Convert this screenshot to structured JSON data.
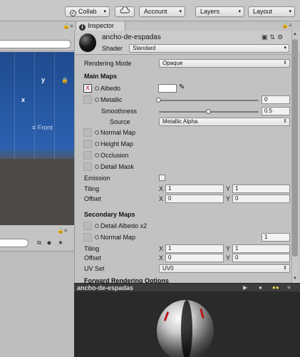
{
  "toolbar": {
    "collab_label": "Collab",
    "account_label": "Account",
    "layers_label": "Layers",
    "layout_label": "Layout"
  },
  "scene": {
    "axis_y": "y",
    "axis_x": "x",
    "view_label": "Front"
  },
  "inspector": {
    "tab_label": "Inspector",
    "material_name": "ancho-de-espadas",
    "shader_label": "Shader",
    "shader_value": "Standard",
    "rendering_mode_label": "Rendering Mode",
    "rendering_mode_value": "Opaque",
    "main_maps_title": "Main Maps",
    "albedo_label": "Albedo",
    "metallic_label": "Metallic",
    "metallic_value": "0",
    "metallic_fraction": 0,
    "smoothness_label": "Smoothness",
    "smoothness_value": "0.5",
    "smoothness_fraction": 0.5,
    "source_label": "Source",
    "source_value": "Metallic Alpha",
    "normal_map_label": "Normal Map",
    "height_map_label": "Height Map",
    "occlusion_label": "Occlusion",
    "detail_mask_label": "Detail Mask",
    "emission_label": "Emission",
    "tiling_label": "Tiling",
    "offset_label": "Offset",
    "x_label": "X",
    "y_label": "Y",
    "tiling_x": "1",
    "tiling_y": "1",
    "offset_x": "0",
    "offset_y": "0",
    "secondary_maps_title": "Secondary Maps",
    "detail_albedo_label": "Detail Albedo x2",
    "sec_normal_map_label": "Normal Map",
    "sec_normal_value": "1",
    "sec_tiling_label": "Tiling",
    "sec_offset_label": "Offset",
    "sec_tiling_x": "1",
    "sec_tiling_y": "1",
    "sec_offset_x": "0",
    "sec_offset_y": "0",
    "uv_set_label": "UV Set",
    "uv_set_value": "UV0",
    "forward_options_title": "Forward Rendering Options"
  },
  "preview": {
    "name": "ancho-de-espadas"
  },
  "colors": {
    "scene_sky": "#2c60b0",
    "scene_ground": "#4d4a45",
    "albedo": "#ffffff",
    "preview_bg": "#2a2a2a"
  }
}
